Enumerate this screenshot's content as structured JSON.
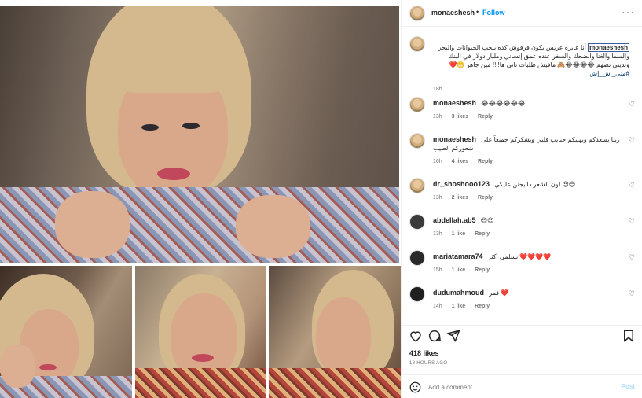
{
  "post": {
    "username": "monaeshesh",
    "dot": "•",
    "follow_label": "Follow",
    "more_icon": "more-horizontal-icon"
  },
  "caption": {
    "username": "monaeshesh",
    "text": " أنا عايزة عريس يكون قرفوش كدة بيحب الحيوانات والبحر والسما والغنا والضحك والسفر عنده عمق إنساني ومليار دولار في البنك ونديني نصهم 😂😂😂😂🙈 مافيش طلبات تاني ها!!!! مين جاهز 😬❤️",
    "hashtag": "#منى_إش_إش",
    "time": "18h"
  },
  "comments": [
    {
      "username": "monaeshesh",
      "text": "😂😂😂😂😂😂",
      "time": "13h",
      "likes": "3 likes",
      "reply": "Reply"
    },
    {
      "username": "monaeshesh",
      "text": "ربنا يسعدكم ويهنيكم حبايب قلبي وبشكركم جميعاً على شعوركم الطيب",
      "time": "16h",
      "likes": "4 likes",
      "reply": "Reply"
    },
    {
      "username": "dr_shoshooo123",
      "text": "لون الشعر دا يجنن عليكي 😍😍",
      "time": "13h",
      "likes": "2 likes",
      "reply": "Reply"
    },
    {
      "username": "abdellah.ab5",
      "text": "😍😍",
      "time": "13h",
      "likes": "1 like",
      "reply": "Reply"
    },
    {
      "username": "mariatamara74",
      "text": "تسلمي أكثر ❤️❤️❤️❤️",
      "time": "15h",
      "likes": "1 like",
      "reply": "Reply"
    },
    {
      "username": "dudumahmoud",
      "text": "قمر ❤️",
      "time": "14h",
      "likes": "1 like",
      "reply": "Reply"
    }
  ],
  "stats": {
    "likes": "418 likes",
    "time": "18 HOURS AGO"
  },
  "add_comment": {
    "placeholder": "Add a comment...",
    "post_label": "Post"
  },
  "colors": {
    "accent": "#0095f6",
    "post_disabled": "#b2dffc",
    "meta": "#737373",
    "heart_red": "#ed4956"
  }
}
